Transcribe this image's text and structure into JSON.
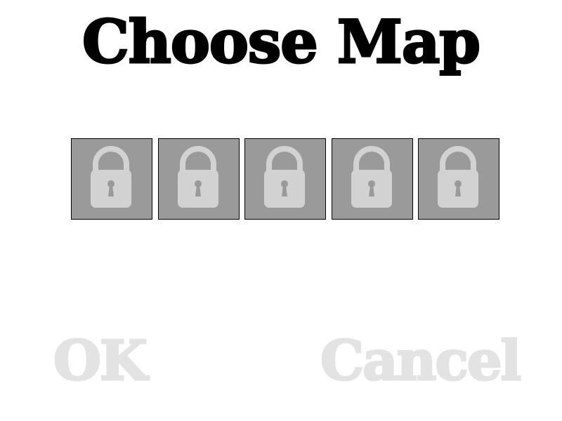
{
  "title": "Choose Map",
  "maps": [
    {
      "state": "locked",
      "icon": "lock-icon"
    },
    {
      "state": "locked",
      "icon": "lock-icon"
    },
    {
      "state": "locked",
      "icon": "lock-icon"
    },
    {
      "state": "locked",
      "icon": "lock-icon"
    },
    {
      "state": "locked",
      "icon": "lock-icon"
    }
  ],
  "buttons": {
    "ok_label": "OK",
    "cancel_label": "Cancel"
  },
  "colors": {
    "slot_fill": "#9a9a9a",
    "lock_fill": "#d2d2d2",
    "disabled_text": "#e3e3e3",
    "title_text": "#000000"
  }
}
